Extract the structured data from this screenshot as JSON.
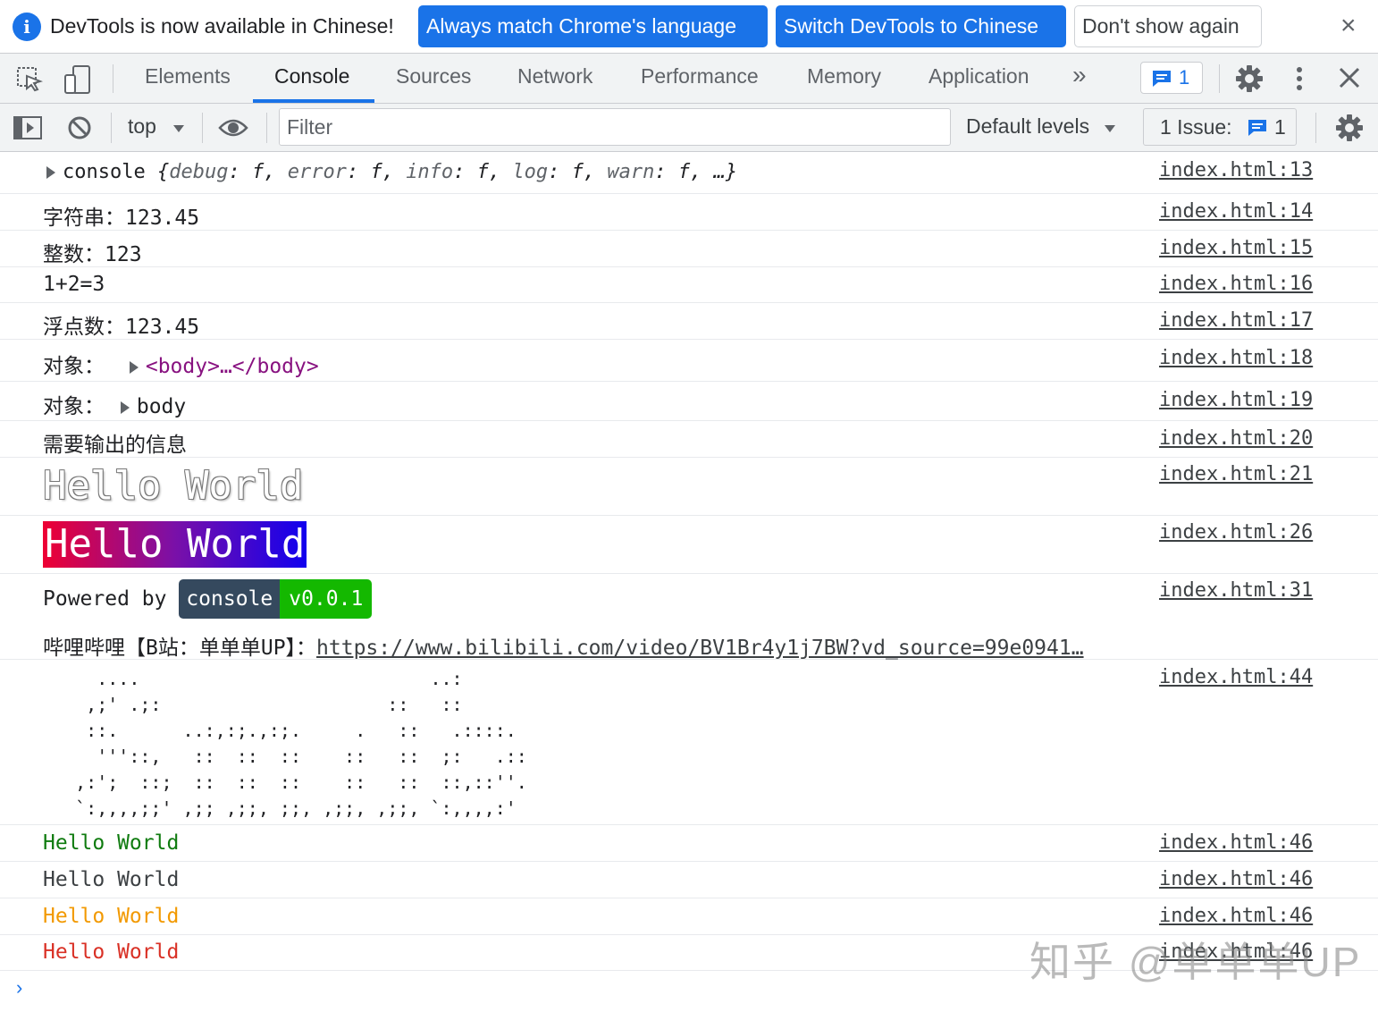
{
  "infobar": {
    "message": "DevTools is now available in Chinese!",
    "btn_match": "Always match Chrome's language",
    "btn_switch": "Switch DevTools to Chinese",
    "btn_dont_show": "Don't show again",
    "close": "×"
  },
  "tabs": {
    "elements": "Elements",
    "console": "Console",
    "sources": "Sources",
    "network": "Network",
    "performance": "Performance",
    "memory": "Memory",
    "application": "Application",
    "more": "»",
    "messages_count": "1"
  },
  "console_toolbar": {
    "context": "top",
    "filter_placeholder": "Filter",
    "levels": "Default levels",
    "issues_label": "1 Issue:",
    "issues_count": "1"
  },
  "messages": [
    {
      "parts": {
        "name": "console",
        "brace_open": "{",
        "k1": "debug",
        "k2": "error",
        "k3": "info",
        "k4": "log",
        "k5": "warn",
        "f": "f",
        "ellipsis": "…}"
      },
      "source": "index.html:13"
    },
    {
      "text": "字符串：123.45",
      "source": "index.html:14"
    },
    {
      "text": "整数：123",
      "source": "index.html:15"
    },
    {
      "text": "1+2=3",
      "source": "index.html:16"
    },
    {
      "text": "浮点数：123.45",
      "source": "index.html:17"
    },
    {
      "label": "对象：",
      "value": "<body>…</body>",
      "source": "index.html:18"
    },
    {
      "label": "对象：",
      "value": "body",
      "source": "index.html:19"
    },
    {
      "text": "需要输出的信息",
      "source": "index.html:20"
    },
    {
      "text": "Hello World",
      "source": "index.html:21"
    },
    {
      "text": "Hello World",
      "source": "index.html:26"
    },
    {
      "prefix": "Powered by ",
      "badge_left": "console",
      "badge_right": "v0.0.1",
      "source": "index.html:31"
    },
    {
      "label": "哔哩哔哩【B站：单单单UP】：",
      "url": "https://www.bilibili.com/video/BV1Br4y1j7BW?vd_source=99e0941…"
    },
    {
      "ascii": "     ....                           ..:\n    ,;' .;:                     ::   ::\n    ::.      ..:,:;.,:;.     .   ::   .::::.\n     '''::,   ::  ::  ::    ::   ::  ;:   .::\n   ,:';  ::;  ::  ::  ::    ::   ::  ::,::''.\n   `:,,,,;;' ,;; ,;;, ;;, ,;;, ,;;, `:,,,,:'",
      "source": "index.html:44"
    },
    {
      "text": "Hello World",
      "color": "#0f7b0f",
      "source": "index.html:46"
    },
    {
      "text": "Hello World",
      "color": "#3c4043",
      "source": "index.html:46"
    },
    {
      "text": "Hello World",
      "color": "#f29900",
      "source": "index.html:46"
    },
    {
      "text": "Hello World",
      "color": "#d93025",
      "source": "index.html:46"
    }
  ],
  "prompt": "›",
  "watermark": "知乎 @单单单UP"
}
